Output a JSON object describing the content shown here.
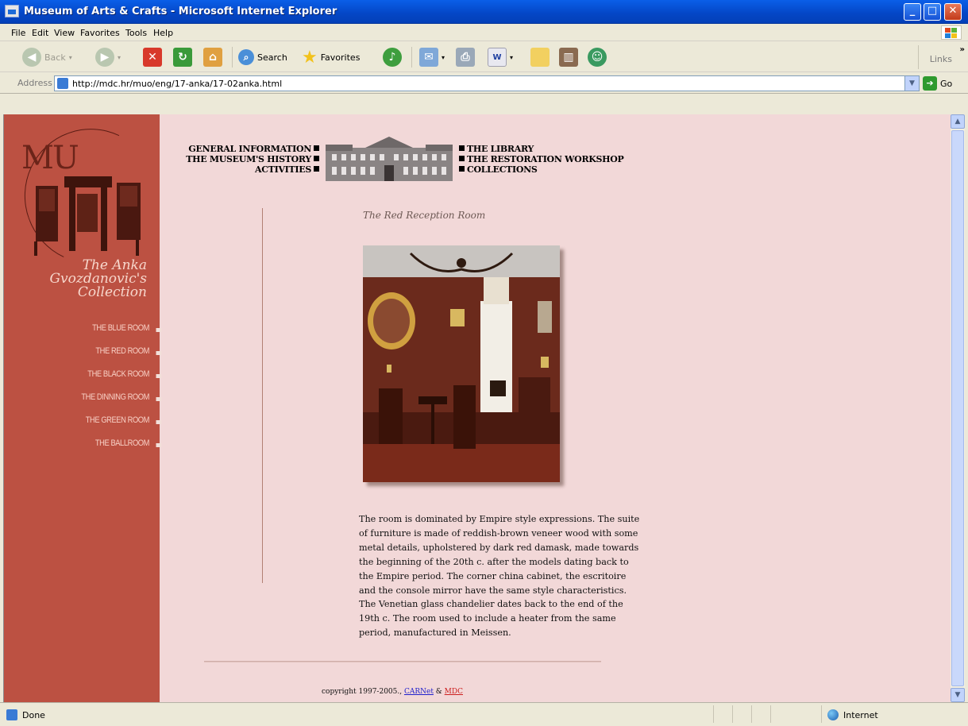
{
  "window": {
    "title": "Museum of Arts & Crafts - Microsoft Internet Explorer",
    "controls": [
      "_",
      "□",
      "✕"
    ]
  },
  "menu": [
    "File",
    "Edit",
    "View",
    "Favorites",
    "Tools",
    "Help"
  ],
  "toolbar": {
    "back_label": "Back",
    "search_label": "Search",
    "favorites_label": "Favorites",
    "links_label": "Links"
  },
  "address": {
    "label": "Address",
    "url": "http://mdc.hr/muo/eng/17-anka/17-02anka.html",
    "go_label": "Go"
  },
  "sidebar": {
    "logo": "MU",
    "collection_title": [
      "The Anka",
      "Gvozdanovic's",
      "Collection"
    ],
    "rooms": [
      "THE BLUE ROOM",
      "THE RED ROOM",
      "THE BLACK ROOM",
      "THE DINNING ROOM",
      "THE GREEN ROOM",
      "THE BALLROOM"
    ]
  },
  "nav": {
    "left": [
      "GENERAL INFORMATION",
      "THE MUSEUM'S HISTORY",
      "ACTIVITIES"
    ],
    "right": [
      "THE LIBRARY",
      "THE RESTORATION WORKSHOP",
      "COLLECTIONS"
    ]
  },
  "main": {
    "caption": "The Red Reception Room",
    "description": "The room is dominated by Empire style expressions. The suite of furniture is made of reddish-brown veneer wood with some metal details, upholstered by dark red damask, made towards the beginning of the 20th c. after the models dating back to the Empire period. The corner china cabinet, the escritoire and the console mirror have the same style characteristics. The Venetian glass chandelier dates back to the end of the 19th c. The room used to include a heater from the same period, manufactured in Meissen.",
    "copyright_prefix": "copyright 1997-2005., ",
    "copyright_link1": "CARNet",
    "copyright_amp": " & ",
    "copyright_link2": "MDC"
  },
  "status": {
    "text": "Done",
    "zone": "Internet"
  },
  "colors": {
    "sidebar": "#BC5142",
    "page_bg": "#F2D8D8",
    "xp_blue": "#0446C5"
  }
}
